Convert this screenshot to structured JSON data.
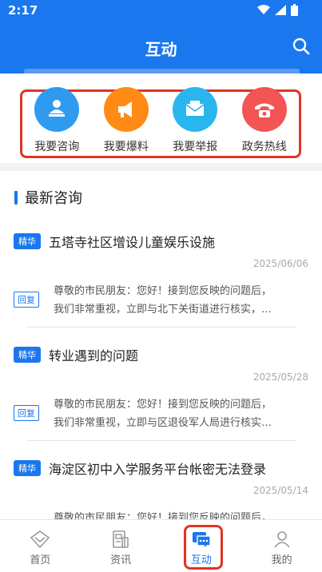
{
  "status_bar": {
    "time": "2:17"
  },
  "header": {
    "title": "互动"
  },
  "quick_actions": [
    {
      "label": "我要咨询",
      "icon": "consult-icon",
      "color": "#2f9bf0"
    },
    {
      "label": "我要爆料",
      "icon": "megaphone-icon",
      "color": "#ff8a16"
    },
    {
      "label": "我要举报",
      "icon": "mail-icon",
      "color": "#29b6ee"
    },
    {
      "label": "政务热线",
      "icon": "phone-icon",
      "color": "#f35454"
    }
  ],
  "section": {
    "title": "最新咨询"
  },
  "consultations": [
    {
      "badge": "精华",
      "title": "五塔寺社区增设儿童娱乐设施",
      "date": "2025/06/06",
      "reply_badge": "回复",
      "reply_line1": "尊敬的市民朋友：您好！接到您反映的问题后，",
      "reply_line2": "我们非常重视，立即与北下关街道进行核实，…"
    },
    {
      "badge": "精华",
      "title": "转业遇到的问题",
      "date": "2025/05/28",
      "reply_badge": "回复",
      "reply_line1": "尊敬的市民朋友：您好！接到您反映的问题后，",
      "reply_line2": "我们非常重视，立即与区退役军人局进行核实…"
    },
    {
      "badge": "精华",
      "title": "海淀区初中入学服务平台帐密无法登录",
      "date": "2025/05/14",
      "reply_badge": "回复",
      "reply_line1": "尊敬的市民朋友：您好！接到您反映的问题后，",
      "reply_line2": ""
    }
  ],
  "tabs": [
    {
      "label": "首页",
      "icon": "home-icon"
    },
    {
      "label": "资讯",
      "icon": "news-icon"
    },
    {
      "label": "互动",
      "icon": "chat-icon",
      "active": true
    },
    {
      "label": "我的",
      "icon": "profile-icon"
    }
  ],
  "colors": {
    "brand": "#1a77ee",
    "highlight": "#e03424"
  }
}
